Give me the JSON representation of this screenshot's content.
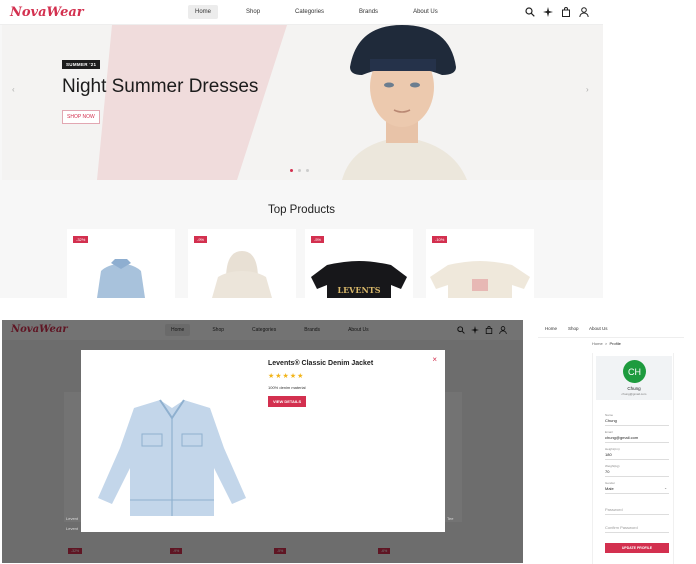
{
  "brand": {
    "name": "NovaWear",
    "accent": "#d3304f"
  },
  "nav": {
    "items": [
      "Home",
      "Shop",
      "Categories",
      "Brands",
      "About Us"
    ],
    "active": "Home"
  },
  "icons": [
    "search-icon",
    "sparkle-icon",
    "cart-icon",
    "user-icon"
  ],
  "hero": {
    "badge": "SUMMER '21",
    "title": "Night Summer Dresses",
    "cta": "SHOP NOW",
    "prev_arrow": "‹",
    "next_arrow": "›",
    "slide_count": 3,
    "active_slide": 1
  },
  "top_products": {
    "title": "Top Products",
    "cards": [
      {
        "discount": "-32%",
        "product": "denim jacket"
      },
      {
        "discount": "-9%",
        "product": "cream hoodie"
      },
      {
        "discount": "-5%",
        "product": "black LEVENTS tee"
      },
      {
        "discount": "-10%",
        "product": "cream graphic tee"
      }
    ],
    "tee_print": "LEVENTS"
  },
  "modal": {
    "title": "Levents® Classic Denim Jacket",
    "rating": "★★★★★",
    "description": "100% denim material",
    "button": "VIEW DETAILS",
    "close": "×",
    "peek_text": {
      "left_1": "Levent",
      "left_2": "Levent",
      "right": "Tee"
    }
  },
  "bg_discounts": [
    "-32%",
    "-9%",
    "-5%",
    "-6%"
  ],
  "profile_page": {
    "nav": [
      "Home",
      "Shop",
      "About Us"
    ],
    "breadcrumb": {
      "home": "Home",
      "sep": ">",
      "current": "Profile"
    },
    "avatar_initials": "CH",
    "name": "Chung",
    "email": "chung@gmail.com",
    "fields": [
      {
        "label": "Name",
        "value": "Chung"
      },
      {
        "label": "Email",
        "value": "chung@gmail.com"
      },
      {
        "label": "Height(cm)",
        "value": "180"
      },
      {
        "label": "Weight(kg)",
        "value": "70"
      },
      {
        "label": "Gender",
        "value": "Male"
      }
    ],
    "password_placeholder": "Password",
    "confirm_placeholder": "Confirm Password",
    "update_button": "UPDATE PROFILE"
  }
}
